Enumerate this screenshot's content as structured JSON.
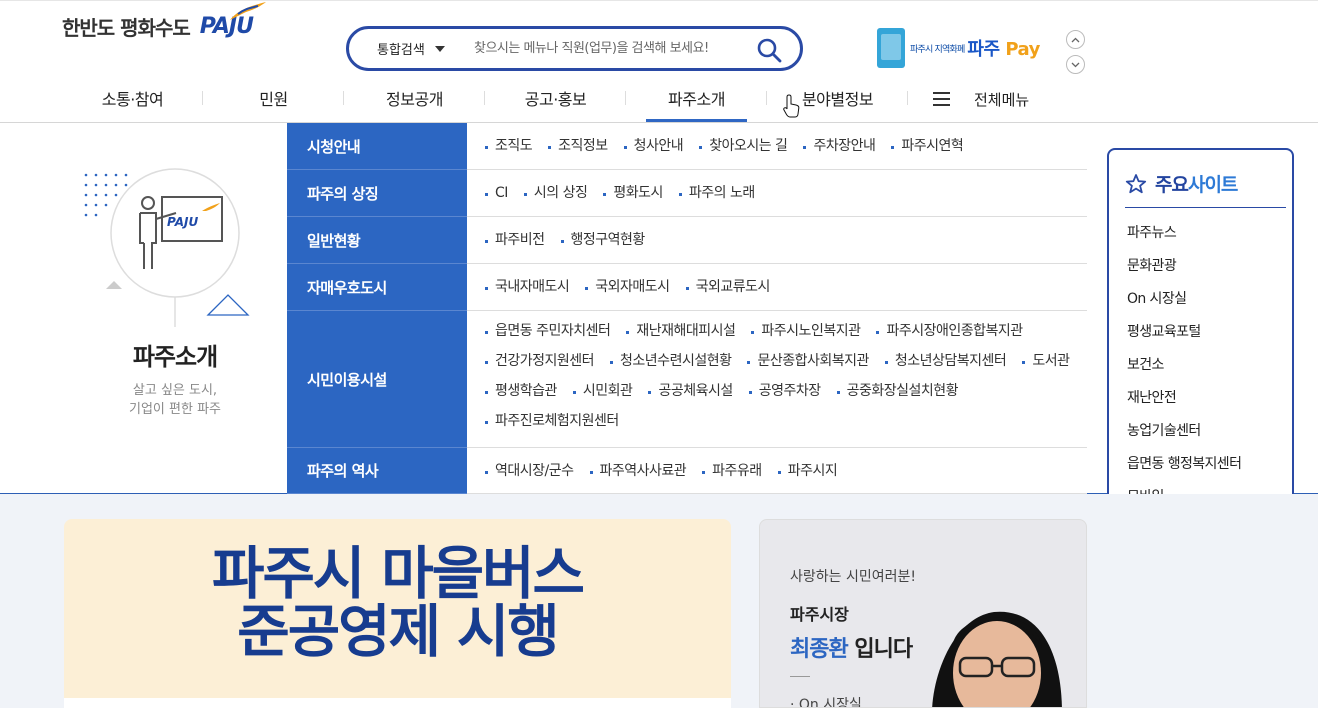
{
  "header": {
    "logo_text": "한반도 평화수도",
    "logo_brand": "PAJU",
    "search": {
      "scope": "통합검색",
      "placeholder": "찾으시는 메뉴나 직원(업무)을 검색해 보세요!"
    },
    "pay": {
      "sub": "파주시 지역화폐",
      "brand": "파주",
      "brand_suffix": "Pay"
    }
  },
  "nav": {
    "items": [
      "소통·참여",
      "민원",
      "정보공개",
      "공고·홍보",
      "파주소개",
      "분야별정보"
    ],
    "active_index": 4,
    "all_menu": "전체메뉴"
  },
  "mega": {
    "title": "파주소개",
    "subtitle_1": "살고 싶은 도시,",
    "subtitle_2": "기업이 편한 파주",
    "illus_brand": "PAJU",
    "categories": [
      {
        "name": "시청안내",
        "links": [
          "조직도",
          "조직정보",
          "청사안내",
          "찾아오시는 길",
          "주차장안내",
          "파주시연혁"
        ]
      },
      {
        "name": "파주의 상징",
        "links": [
          "CI",
          "시의 상징",
          "평화도시",
          "파주의 노래"
        ]
      },
      {
        "name": "일반현황",
        "links": [
          "파주비전",
          "행정구역현황"
        ]
      },
      {
        "name": "자매우호도시",
        "links": [
          "국내자매도시",
          "국외자매도시",
          "국외교류도시"
        ]
      },
      {
        "name": "시민이용시설",
        "links": [
          "읍면동 주민자치센터",
          "재난재해대피시설",
          "파주시노인복지관",
          "파주시장애인종합복지관",
          "건강가정지원센터",
          "청소년수련시설현황",
          "문산종합사회복지관",
          "청소년상담복지센터",
          "도서관",
          "평생학습관",
          "시민회관",
          "공공체육시설",
          "공영주차장",
          "공중화장실설치현황",
          "파주진로체험지원센터"
        ]
      },
      {
        "name": "파주의 역사",
        "links": [
          "역대시장/군수",
          "파주역사사료관",
          "파주유래",
          "파주시지"
        ]
      }
    ]
  },
  "sites": {
    "title_a": "주요",
    "title_b": "사이트",
    "items": [
      "파주뉴스",
      "문화관광",
      "On 시장실",
      "평생교육포털",
      "보건소",
      "재난안전",
      "농업기술센터",
      "읍면동 행정복지센터",
      "모바일"
    ]
  },
  "banner": {
    "line1": "파주시 마을버스",
    "line2": "준공영제 시행"
  },
  "mayor": {
    "greeting": "사랑하는 시민여러분!",
    "role": "파주시장",
    "name": "최종환",
    "name_suffix": " 입니다",
    "link": "On 시장실"
  },
  "colors": {
    "primary": "#2c66c2",
    "navy": "#2a4aa5",
    "banner_bg": "#fcefd6",
    "banner_text": "#173c8f"
  }
}
